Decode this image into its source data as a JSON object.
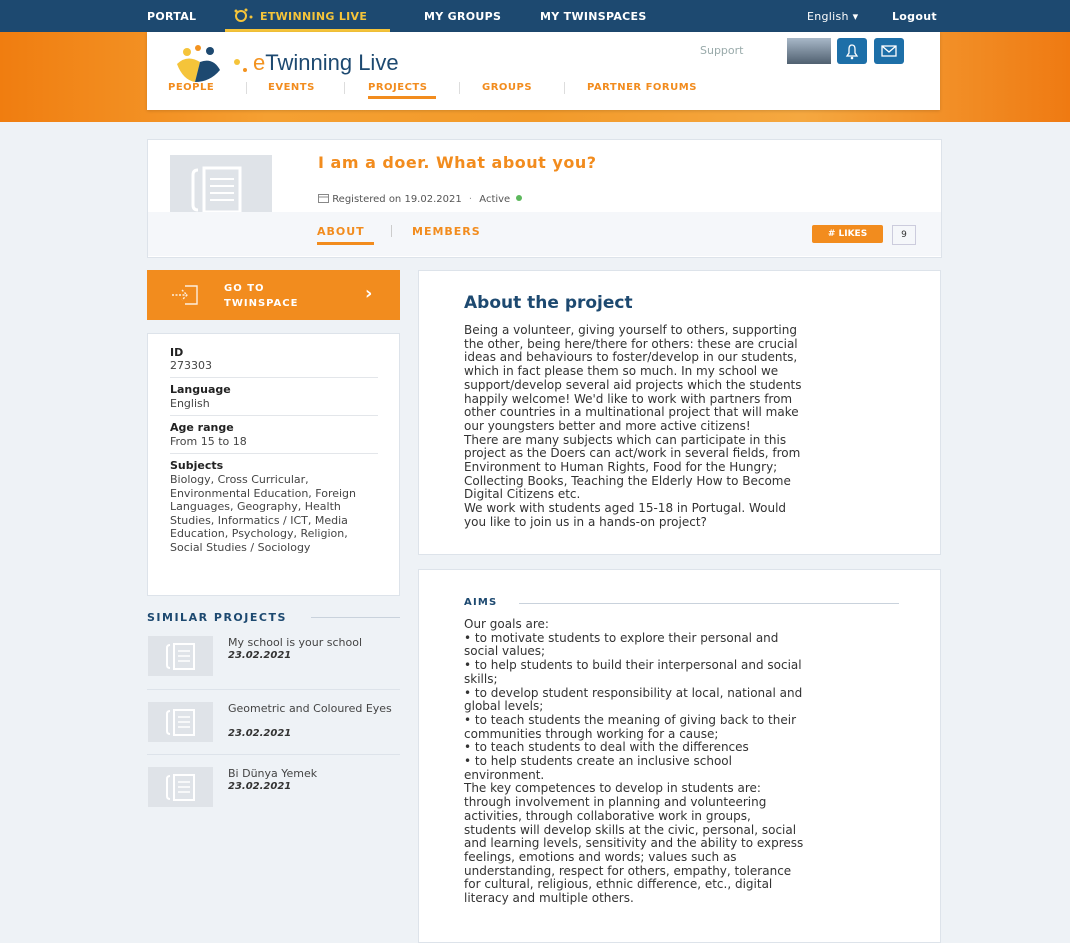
{
  "topnav": {
    "portal": "PORTAL",
    "etwinning_live": "ETWINNING LIVE",
    "my_groups": "MY GROUPS",
    "my_twinspaces": "MY TWINSPACES",
    "language": "English",
    "logout": "Logout"
  },
  "header": {
    "logo_e": "e",
    "logo_rest": "Twinning Live",
    "support": "Support",
    "nav": [
      "PEOPLE",
      "EVENTS",
      "PROJECTS",
      "GROUPS",
      "PARTNER FORUMS"
    ],
    "active_nav": "PROJECTS"
  },
  "project": {
    "title": "I am a doer. What about you?",
    "registered": "Registered on 19.02.2021",
    "separator": "·",
    "status": "Active",
    "tabs": [
      "ABOUT",
      "MEMBERS"
    ],
    "active_tab": "ABOUT",
    "likes_label": "# LIKES",
    "likes_count": "9"
  },
  "goto": {
    "line1": "GO TO",
    "line2": "TWINSPACE",
    "arrow": "›"
  },
  "info": {
    "id_label": "ID",
    "id_value": "273303",
    "language_label": "Language",
    "language_value": "English",
    "age_label": "Age range",
    "age_value": "From 15 to 18",
    "subjects_label": "Subjects",
    "subjects_value": "Biology, Cross Curricular, Environmental Education, Foreign Languages, Geography, Health Studies, Informatics / ICT, Media Education, Psychology, Religion, Social Studies / Sociology"
  },
  "similar": {
    "heading": "SIMILAR PROJECTS",
    "items": [
      {
        "title": "My school is your school",
        "date": "23.02.2021"
      },
      {
        "title": "Geometric and Coloured Eyes",
        "date": "23.02.2021"
      },
      {
        "title": "Bi Dünya Yemek",
        "date": "23.02.2021"
      }
    ]
  },
  "about": {
    "heading": "About the project",
    "text": "Being a volunteer, giving yourself to others, supporting\nthe other, being here/there for others: these are crucial\nideas and behaviours to foster/develop in our students,\nwhich in fact please them so much. In my school we\nsupport/develop several aid projects which the students\nhappily welcome! We'd like to work with partners from\nother countries in a multinational project that will make\nour youngsters better and more active citizens!\nThere are many subjects which can participate in this\nproject as the Doers can act/work in several fields, from\nEnvironment to Human Rights, Food for the Hungry;\nCollecting Books, Teaching the Elderly How to Become\nDigital Citizens etc.\nWe work with students aged 15-18 in Portugal. Would\nyou like to join us in a hands-on project?"
  },
  "aims": {
    "heading": "AIMS",
    "text": "Our goals are:\n• to motivate students to explore their personal and\nsocial values;\n• to help students to build their interpersonal and social\nskills;\n• to develop student responsibility at local, national and\nglobal levels;\n• to teach students the meaning of giving back to their\ncommunities through working for a cause;\n• to teach students to deal with the differences\n• to help students create an inclusive school\nenvironment.\nThe key competences to develop in students are:\nthrough involvement in planning and volunteering\nactivities, through collaborative work in groups,\nstudents will develop skills at the civic, personal, social\nand learning levels, sensitivity and the ability to express\nfeelings, emotions and words; values such as\nunderstanding, respect for others, empathy, tolerance\nfor cultural, religious, ethnic difference, etc., digital\nliteracy and multiple others."
  },
  "colors": {
    "navy": "#1d4970",
    "orange": "#f28c1e",
    "active_green": "#5cb85c"
  }
}
